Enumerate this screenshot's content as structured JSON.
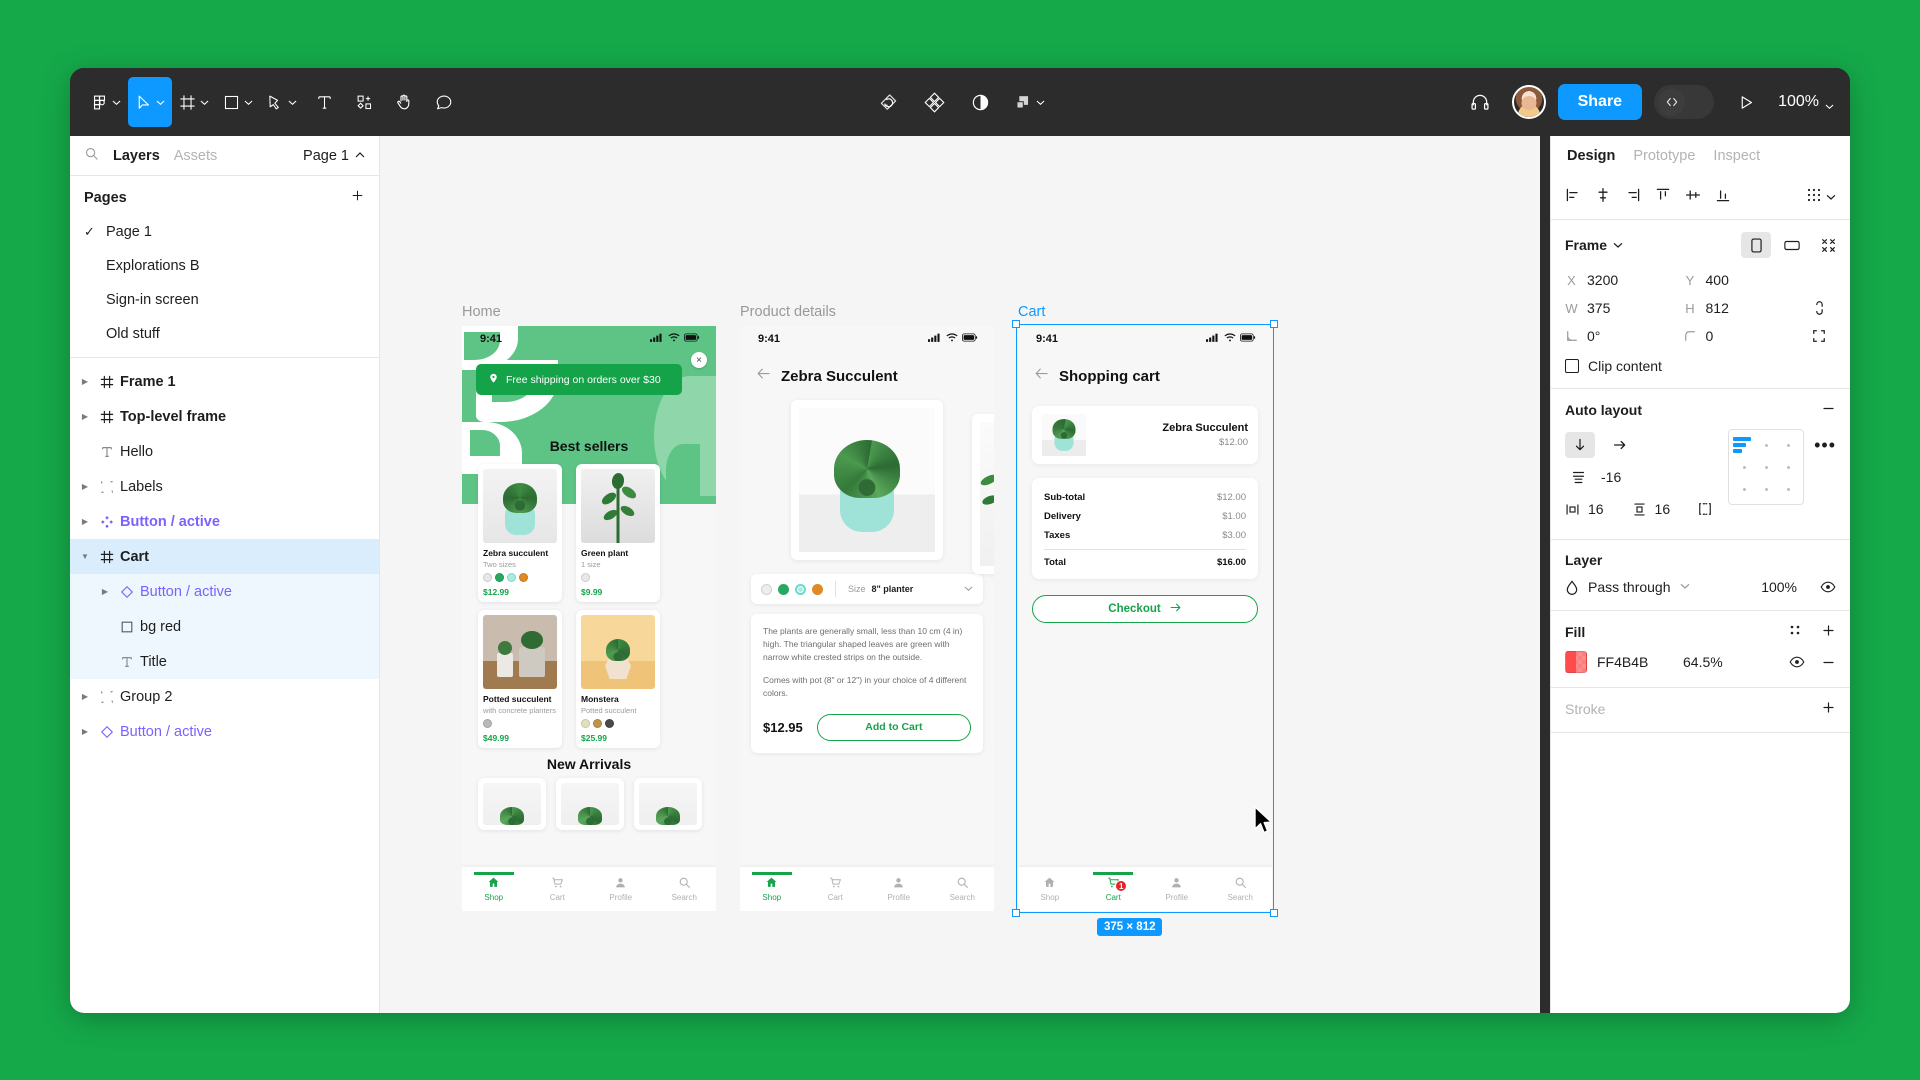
{
  "app": {
    "zoom_level": "100%",
    "share_label": "Share",
    "accent_blue": "#0d99ff",
    "brand_green": "#16a34a"
  },
  "toolbar": {
    "tools": [
      {
        "name": "figma-menu-icon",
        "has_caret": true
      },
      {
        "name": "move-tool-icon",
        "has_caret": true,
        "active": true
      },
      {
        "name": "frame-tool-icon",
        "has_caret": true
      },
      {
        "name": "shape-tool-icon",
        "has_caret": true
      },
      {
        "name": "pen-tool-icon",
        "has_caret": true
      },
      {
        "name": "text-tool-icon",
        "has_caret": false
      },
      {
        "name": "resources-tool-icon",
        "has_caret": false
      },
      {
        "name": "hand-tool-icon",
        "has_caret": false
      },
      {
        "name": "comment-tool-icon",
        "has_caret": false
      }
    ],
    "center_actions": [
      {
        "name": "actions-icon"
      },
      {
        "name": "plugins-icon"
      },
      {
        "name": "variables-icon"
      },
      {
        "name": "boolean-icon",
        "has_caret": true
      }
    ]
  },
  "left_panel": {
    "tabs": [
      {
        "label": "Layers",
        "active": true
      },
      {
        "label": "Assets",
        "active": false
      }
    ],
    "page_selector": "Page 1",
    "pages_header": "Pages",
    "pages": [
      {
        "label": "Page 1",
        "current": true
      },
      {
        "label": "Explorations B",
        "current": false
      },
      {
        "label": "Sign-in screen",
        "current": false
      },
      {
        "label": "Old stuff",
        "current": false
      }
    ],
    "layers": [
      {
        "label": "Frame 1",
        "icon": "frame-icon",
        "style": "bold",
        "arrow": true,
        "indent": 0
      },
      {
        "label": "Top-level frame",
        "icon": "frame-icon",
        "style": "bold",
        "arrow": true,
        "indent": 0
      },
      {
        "label": "Hello",
        "icon": "text-icon",
        "style": "normal",
        "arrow": false,
        "indent": 0
      },
      {
        "label": "Labels",
        "icon": "group-icon",
        "style": "normal",
        "arrow": true,
        "indent": 0
      },
      {
        "label": "Button / active",
        "icon": "component-icon",
        "style": "component",
        "arrow": true,
        "indent": 0
      },
      {
        "label": "Cart",
        "icon": "frame-icon",
        "style": "bold",
        "arrow": true,
        "indent": 0,
        "selected": true,
        "expanded": true
      },
      {
        "label": "Button / active",
        "icon": "instance-icon",
        "style": "component-instance",
        "arrow": true,
        "indent": 1,
        "child": true
      },
      {
        "label": "bg red",
        "icon": "rect-icon",
        "style": "normal",
        "arrow": false,
        "indent": 1,
        "child": true
      },
      {
        "label": "Title",
        "icon": "text-icon",
        "style": "normal",
        "arrow": false,
        "indent": 1,
        "child": true
      },
      {
        "label": "Group 2",
        "icon": "group-icon",
        "style": "normal",
        "arrow": true,
        "indent": 0
      },
      {
        "label": "Button / active",
        "icon": "instance-icon",
        "style": "component-instance",
        "arrow": true,
        "indent": 0
      }
    ]
  },
  "right_panel": {
    "tabs": [
      {
        "label": "Design",
        "active": true
      },
      {
        "label": "Prototype",
        "active": false
      },
      {
        "label": "Inspect",
        "active": false
      }
    ],
    "frame": {
      "type_label": "Frame",
      "x_key": "X",
      "x_value": "3200",
      "y_key": "Y",
      "y_value": "400",
      "w_key": "W",
      "w_value": "375",
      "h_key": "H",
      "h_value": "812",
      "rotation": "0°",
      "corner_radius": "0",
      "clip_content_label": "Clip content",
      "clip_content_checked": false
    },
    "auto_layout": {
      "title": "Auto layout",
      "direction": "vertical",
      "gap": "-16",
      "padding_horizontal": "16",
      "padding_vertical": "16"
    },
    "layer": {
      "title": "Layer",
      "blend_mode": "Pass through",
      "opacity": "100%"
    },
    "fill": {
      "title": "Fill",
      "color_hex": "FF4B4B",
      "opacity": "64.5%"
    },
    "stroke": {
      "title": "Stroke"
    }
  },
  "canvas": {
    "selection_size_badge": "375 × 812",
    "frames": [
      {
        "label": "Home",
        "selected": false
      },
      {
        "label": "Product details",
        "selected": false
      },
      {
        "label": "Cart",
        "selected": true
      }
    ],
    "home_screen": {
      "status_time": "9:41",
      "banner_text": "Free shipping on orders over $30",
      "banner_close": "×",
      "section_best_sellers": "Best sellers",
      "section_new_arrivals": "New Arrivals",
      "products": [
        {
          "title": "Zebra succulent",
          "subtitle": "Two sizes",
          "price": "$12.99",
          "swatches": [
            "#e8e8e8",
            "#27a963",
            "#a8ece0",
            "#e08a21"
          ]
        },
        {
          "title": "Green plant",
          "subtitle": "1 size",
          "price": "$9.99",
          "swatches": [
            "#e8e8e8"
          ]
        },
        {
          "title": "Potted succulent",
          "subtitle": "with concrete planters",
          "price": "$49.99",
          "swatches": [
            "#b9b9b9"
          ]
        },
        {
          "title": "Monstera",
          "subtitle": "Potted succulent",
          "price": "$25.99",
          "swatches": [
            "#e4e0bd",
            "#bb9549",
            "#4a4a4a"
          ]
        }
      ],
      "nav": [
        {
          "label": "Shop",
          "icon": "home-icon",
          "active": true
        },
        {
          "label": "Cart",
          "icon": "cart-icon",
          "active": false
        },
        {
          "label": "Profile",
          "icon": "profile-icon",
          "active": false
        },
        {
          "label": "Search",
          "icon": "search-icon",
          "active": false
        }
      ]
    },
    "details_screen": {
      "status_time": "9:41",
      "back_icon": "back-arrow-icon",
      "title": "Zebra Succulent",
      "swatches": [
        "#ededed",
        "#27a963",
        "#a8ece0",
        "#e08a21"
      ],
      "selected_swatch_index": 2,
      "size_label": "Size",
      "size_value": "8\" planter",
      "description_1": "The plants are generally small, less than 10 cm (4 in) high. The triangular shaped leaves are green with narrow white crested strips on the outside.",
      "description_2": "Comes with pot (8\" or 12\") in your choice of 4 different colors.",
      "price": "$12.95",
      "add_to_cart_label": "Add to Cart",
      "nav": [
        {
          "label": "Shop",
          "icon": "home-icon",
          "active": true
        },
        {
          "label": "Cart",
          "icon": "cart-icon",
          "active": false
        },
        {
          "label": "Profile",
          "icon": "profile-icon",
          "active": false
        },
        {
          "label": "Search",
          "icon": "search-icon",
          "active": false
        }
      ]
    },
    "cart_screen": {
      "status_time": "9:41",
      "back_icon": "back-arrow-icon",
      "title": "Shopping cart",
      "item_name": "Zebra Succulent",
      "item_price": "$12.00",
      "totals": [
        {
          "label": "Sub-total",
          "value": "$12.00"
        },
        {
          "label": "Delivery",
          "value": "$1.00"
        },
        {
          "label": "Taxes",
          "value": "$3.00"
        }
      ],
      "total_label": "Total",
      "total_value": "$16.00",
      "checkout_label": "Checkout",
      "nav": [
        {
          "label": "Shop",
          "icon": "home-icon",
          "active": false
        },
        {
          "label": "Cart",
          "icon": "cart-icon",
          "active": true,
          "badge": "1"
        },
        {
          "label": "Profile",
          "icon": "profile-icon",
          "active": false
        },
        {
          "label": "Search",
          "icon": "search-icon",
          "active": false
        }
      ]
    }
  }
}
